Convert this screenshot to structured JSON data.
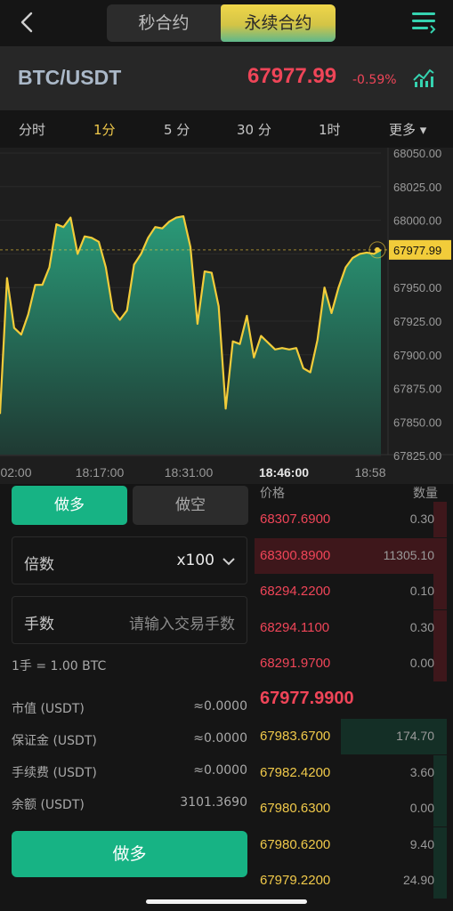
{
  "top": {
    "tabs": [
      "秒合约",
      "永续合约"
    ],
    "active_tab": "永续合约"
  },
  "ticker": {
    "pair": "BTC/USDT",
    "price": "67977.99",
    "change": "-0.59%"
  },
  "timeframes": [
    "分时",
    "1分",
    "5 分",
    "30 分",
    "1时",
    "更多 ▾"
  ],
  "active_timeframe": "1分",
  "chart_data": {
    "type": "area",
    "y_ticks": [
      "68050.00",
      "68025.00",
      "68000.00",
      "67950.00",
      "67925.00",
      "67900.00",
      "67875.00",
      "67850.00",
      "67825.00"
    ],
    "x_ticks": [
      "02:00",
      "18:17:00",
      "18:31:00",
      "18:46:00",
      "18:58"
    ],
    "current_price_label": "67977.99",
    "ylim": [
      67825,
      68050
    ],
    "values": [
      67856,
      67957,
      67920,
      67915,
      67930,
      67952,
      67952,
      67965,
      67997,
      67995,
      68002,
      67975,
      67988,
      67987,
      67984,
      67965,
      67933,
      67926,
      67933,
      67967,
      67975,
      67987,
      67995,
      67994,
      67999,
      68002,
      68003,
      67980,
      67923,
      67962,
      67961,
      67936,
      67860,
      67910,
      67908,
      67929,
      67898,
      67914,
      67909,
      67904,
      67905,
      67904,
      67905,
      67890,
      67887,
      67911,
      67950,
      67931,
      67950,
      67965,
      67972,
      67975,
      67976,
      67975,
      67978
    ],
    "line_color": "#f2cc3a",
    "fill_top": "#2a9a78",
    "fill_bottom": "#1f3a33"
  },
  "form": {
    "buy_tab": "做多",
    "sell_tab": "做空",
    "leverage_label": "倍数",
    "leverage_value": "x100",
    "qty_label": "手数",
    "qty_placeholder": "请输入交易手数",
    "lot_info": "1手 = 1.00 BTC",
    "rows": [
      {
        "label": "市值 (USDT)",
        "value": "≈0.0000"
      },
      {
        "label": "保证金 (USDT)",
        "value": "≈0.0000"
      },
      {
        "label": "手续费 (USDT)",
        "value": "≈0.0000"
      },
      {
        "label": "余额 (USDT)",
        "value": "3101.3690"
      }
    ],
    "submit": "做多"
  },
  "orderbook": {
    "price_header": "价格",
    "qty_header": "数量",
    "asks": [
      {
        "price": "68307.6900",
        "qty": "0.30",
        "depth": 0.07
      },
      {
        "price": "68300.8900",
        "qty": "11305.10",
        "depth": 1.0
      },
      {
        "price": "68294.2200",
        "qty": "0.10",
        "depth": 0.07
      },
      {
        "price": "68294.1100",
        "qty": "0.30",
        "depth": 0.07
      },
      {
        "price": "68291.9700",
        "qty": "0.00",
        "depth": 0.07
      }
    ],
    "mid_price": "67977.9900",
    "bids": [
      {
        "price": "67983.6700",
        "qty": "174.70",
        "depth": 0.55
      },
      {
        "price": "67982.4200",
        "qty": "3.60",
        "depth": 0.07
      },
      {
        "price": "67980.6300",
        "qty": "0.00",
        "depth": 0.07
      },
      {
        "price": "67980.6200",
        "qty": "9.40",
        "depth": 0.07
      },
      {
        "price": "67979.2200",
        "qty": "24.90",
        "depth": 0.07
      }
    ]
  }
}
